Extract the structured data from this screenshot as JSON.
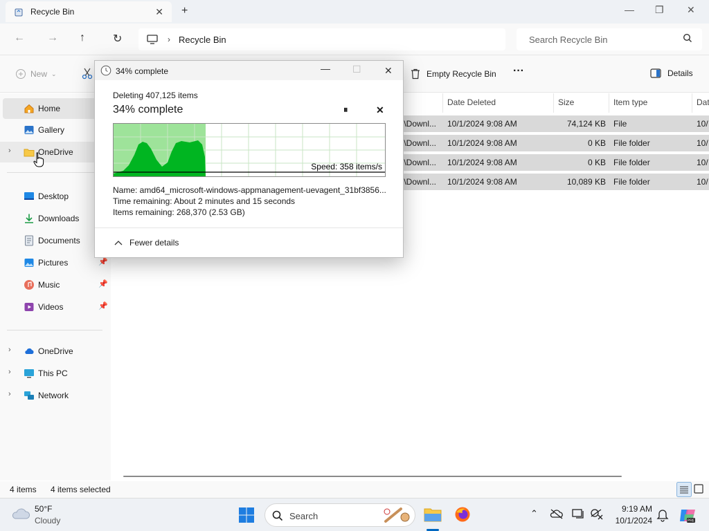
{
  "window": {
    "tab_title": "Recycle Bin",
    "close_tab": "✕",
    "new_tab": "+"
  },
  "address": {
    "crumb": "Recycle Bin",
    "search_placeholder": "Search Recycle Bin"
  },
  "command_bar": {
    "new_label": "New",
    "empty_label": "Empty Recycle Bin",
    "more_label": "···",
    "details_label": "Details"
  },
  "sidebar": {
    "items": [
      {
        "label": "Home"
      },
      {
        "label": "Gallery"
      },
      {
        "label": "OneDrive"
      },
      {
        "label": "Desktop"
      },
      {
        "label": "Downloads"
      },
      {
        "label": "Documents"
      },
      {
        "label": "Pictures"
      },
      {
        "label": "Music"
      },
      {
        "label": "Videos"
      },
      {
        "label": "OneDrive"
      },
      {
        "label": "This PC"
      },
      {
        "label": "Network"
      }
    ]
  },
  "table": {
    "headers": [
      "Date Deleted",
      "Size",
      "Item type",
      "Dat"
    ],
    "rows": [
      {
        "path": ":\\Downl...",
        "date": "10/1/2024 9:08 AM",
        "size": "74,124 KB",
        "type": "File",
        "extra": "10/"
      },
      {
        "path": ":\\Downl...",
        "date": "10/1/2024 9:08 AM",
        "size": "0 KB",
        "type": "File folder",
        "extra": "10/"
      },
      {
        "path": ":\\Downl...",
        "date": "10/1/2024 9:08 AM",
        "size": "0 KB",
        "type": "File folder",
        "extra": "10/"
      },
      {
        "path": ":\\Downl...",
        "date": "10/1/2024 9:08 AM",
        "size": "10,089 KB",
        "type": "File folder",
        "extra": "10/"
      }
    ]
  },
  "status": {
    "items": "4 items",
    "selected": "4 items selected"
  },
  "dialog": {
    "title": "34% complete",
    "heading_small": "Deleting 407,125 items",
    "heading_large": "34% complete",
    "speed": "Speed: 358 items/s",
    "name_line": "Name:  amd64_microsoft-windows-appmanagement-uevagent_31bf3856...",
    "time_line": "Time remaining:  About 2 minutes and 15 seconds",
    "items_line": "Items remaining:  268,370 (2.53 GB)",
    "fewer_details": "Fewer details",
    "progress": 0.34
  },
  "taskbar": {
    "temp": "50°F",
    "weather": "Cloudy",
    "search": "Search",
    "time": "9:19 AM",
    "date": "10/1/2024"
  },
  "colors": {
    "progress_fill": "#9ee39a",
    "graph_area": "#00b521",
    "accent": "#0067c0"
  }
}
